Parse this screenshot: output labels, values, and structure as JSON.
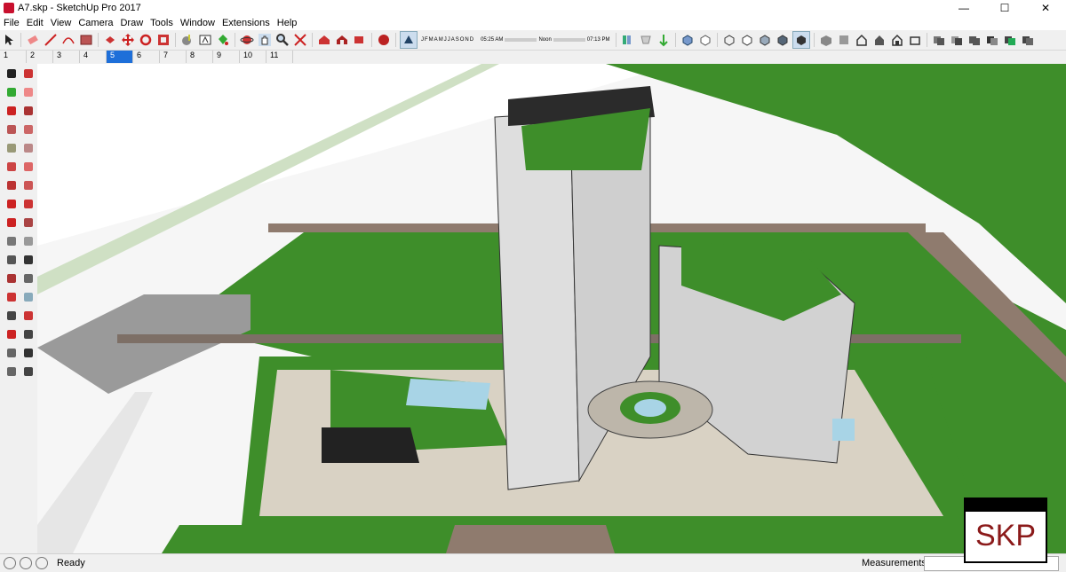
{
  "window": {
    "title": "A7.skp - SketchUp Pro 2017",
    "minimize": "—",
    "maximize": "☐",
    "close": "✕"
  },
  "menu": [
    "File",
    "Edit",
    "View",
    "Camera",
    "Draw",
    "Tools",
    "Window",
    "Extensions",
    "Help"
  ],
  "shadow_bar": {
    "months": [
      "J",
      "F",
      "M",
      "A",
      "M",
      "J",
      "J",
      "A",
      "S",
      "O",
      "N",
      "D"
    ],
    "time_start": "05:25 AM",
    "time_mid": "Noon",
    "time_end": "07:13 PM"
  },
  "scene_tabs": [
    "1",
    "2",
    "3",
    "4",
    "5",
    "6",
    "7",
    "8",
    "9",
    "10",
    "11"
  ],
  "active_tab_index": 4,
  "status": {
    "text": "Ready",
    "measurements_label": "Measurements",
    "measurements_value": ""
  },
  "logo": {
    "text": "SKP"
  },
  "colors": {
    "grass": "#3e8e2a",
    "road": "#8f7b6e",
    "plaza": "#d9d2c4",
    "accent": "#1e6fd9",
    "logo_text": "#8b1a1a"
  },
  "icons": {
    "toolbar": [
      "select-icon",
      "eraser-icon",
      "line-icon",
      "arc-icon",
      "rectangle-icon",
      "push-pull-icon",
      "move-icon",
      "rotate-icon",
      "offset-icon",
      "tape-measure-icon",
      "text-icon",
      "paint-bucket-icon",
      "orbit-icon",
      "pan-icon",
      "zoom-icon",
      "zoom-extents-icon",
      "warehouse-icon",
      "extension-warehouse-icon",
      "layout-icon",
      "shadow-toggle-icon",
      "fog-icon",
      "section-plane-icon",
      "xray-icon",
      "wireframe-icon",
      "hidden-line-icon",
      "shaded-icon",
      "textured-icon",
      "monochrome-icon",
      "iso-icon",
      "top-view-icon",
      "front-view-icon",
      "right-view-icon",
      "back-view-icon",
      "left-view-icon",
      "outer-shell-icon",
      "intersect-icon",
      "union-icon",
      "subtract-icon",
      "trim-icon",
      "split-icon"
    ],
    "left": [
      "select-icon",
      "make-component-icon",
      "paint-bucket-icon",
      "eraser-icon",
      "line-icon",
      "freehand-icon",
      "rectangle-icon",
      "rotated-rectangle-icon",
      "circle-icon",
      "polygon-icon",
      "arc-icon",
      "pie-icon",
      "offset-icon",
      "follow-me-icon",
      "move-icon",
      "push-pull-icon",
      "rotate-icon",
      "scale-icon",
      "tape-measure-icon",
      "dimension-icon",
      "protractor-icon",
      "text-icon",
      "axes-icon",
      "3d-text-icon",
      "orbit-icon",
      "pan-icon",
      "zoom-icon",
      "zoom-window-icon",
      "zoom-extents-icon",
      "previous-view-icon",
      "walk-icon",
      "look-around-icon",
      "position-camera-icon",
      "section-plane-icon"
    ]
  }
}
